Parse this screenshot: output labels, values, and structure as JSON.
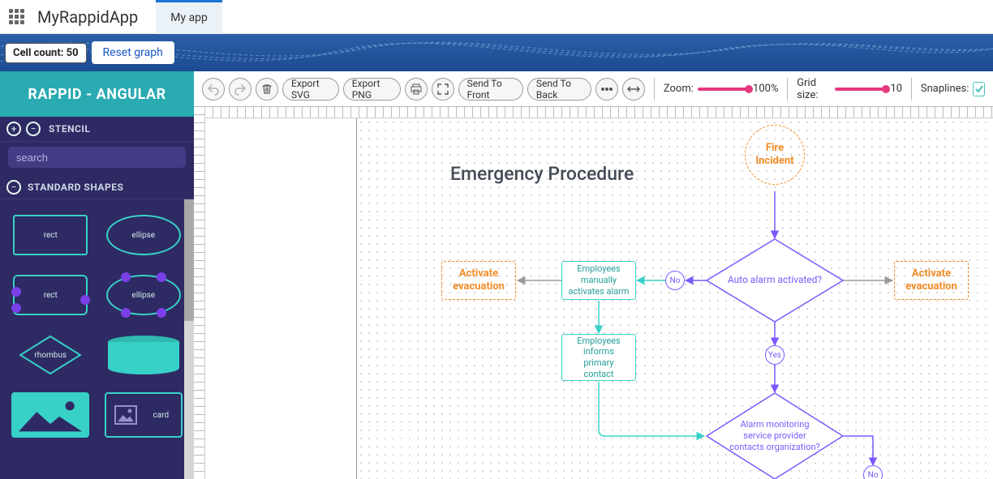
{
  "app": {
    "name": "MyRappidApp",
    "tab": "My app"
  },
  "header": {
    "cell_count_label": "Cell count: 50",
    "reset_label": "Reset graph"
  },
  "sidebar": {
    "title": "RAPPID - ANGULAR",
    "stencil_label": "STENCIL",
    "search_placeholder": "search",
    "group_label": "STANDARD SHAPES",
    "shapes": {
      "rect": "rect",
      "ellipse": "ellipse",
      "rect_ports": "rect",
      "ellipse_ports": "ellipse",
      "rhombus": "rhombus",
      "card": "card"
    }
  },
  "toolbar": {
    "export_svg": "Export SVG",
    "export_png": "Export PNG",
    "send_front": "Send To Front",
    "send_back": "Send To Back",
    "zoom_label": "Zoom:",
    "zoom_value": "100%",
    "grid_label": "Grid size:",
    "grid_value": "10",
    "snaplines_label": "Snaplines:"
  },
  "diagram": {
    "title": "Emergency Procedure",
    "nodes": {
      "fire_incident": "Fire\nIncident",
      "auto_alarm": "Auto alarm activated?",
      "activate_left": "Activate\nevacuation",
      "activate_right": "Activate\nevacuation",
      "emp_manual": "Employees\nmanually\nactivates alarm",
      "emp_inform": "Employees\ninforms\nprimary\ncontact",
      "svc_provider": "Alarm monitoring\nservice provider\ncontacts organization?"
    },
    "labels": {
      "no": "No",
      "yes": "Yes"
    }
  },
  "colors": {
    "teal": "#38d1c7",
    "purple": "#7b59ff",
    "orange": "#f28c28",
    "blue_header": "#1c4b91"
  }
}
